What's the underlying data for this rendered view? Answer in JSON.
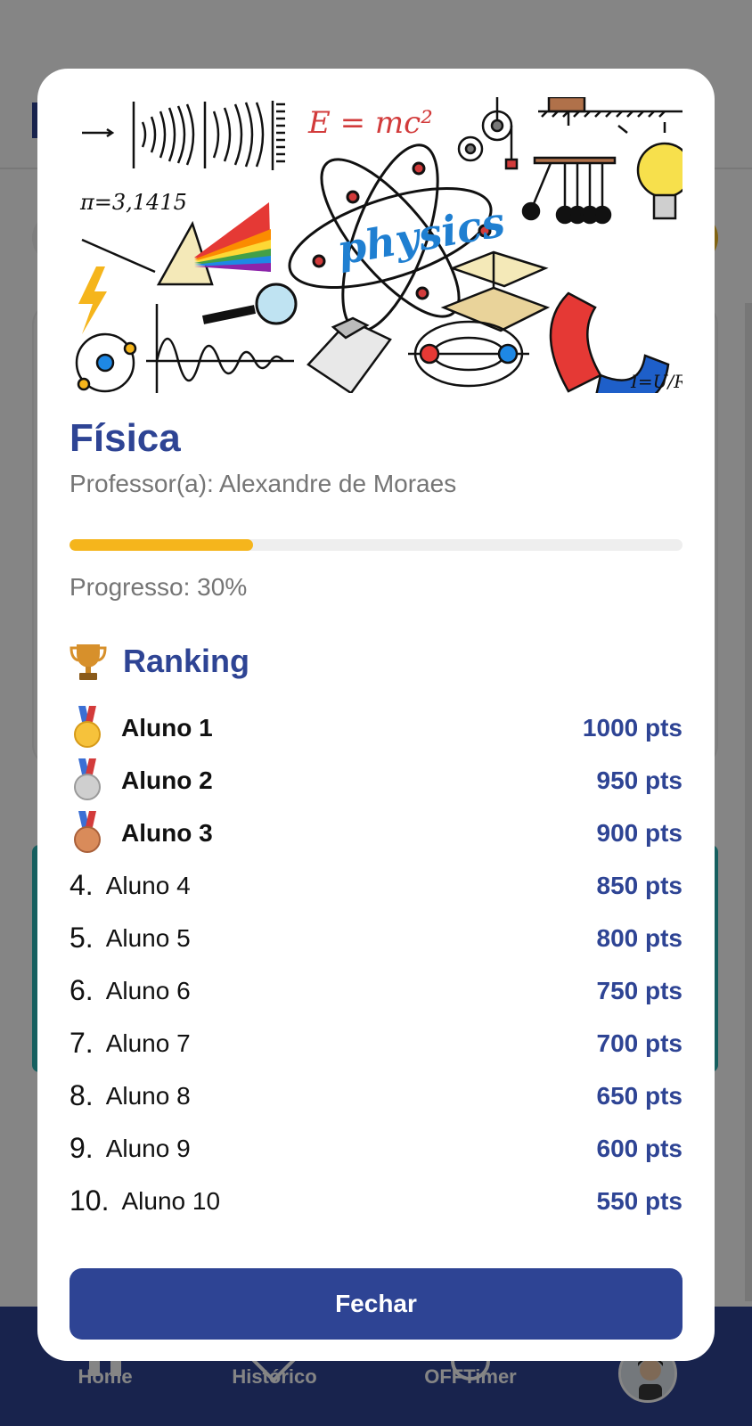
{
  "modal": {
    "course_title": "Física",
    "teacher": "Professor(a): Alexandre de Moraes",
    "progress_percent": 30,
    "progress_text": "Progresso: 30%",
    "ranking_title": "Ranking",
    "ranking_icon": "trophy-icon",
    "hero_text": {
      "formula": "E = mc²",
      "pi": "π=3,1415",
      "word": "physics",
      "ohm": "I=U/R"
    },
    "ranking": [
      {
        "position": "1.",
        "medal": "gold",
        "name": "Aluno 1",
        "points": "1000 pts"
      },
      {
        "position": "2.",
        "medal": "silver",
        "name": "Aluno 2",
        "points": "950 pts"
      },
      {
        "position": "3.",
        "medal": "bronze",
        "name": "Aluno 3",
        "points": "900 pts"
      },
      {
        "position": "4.",
        "medal": "",
        "name": "Aluno 4",
        "points": "850 pts"
      },
      {
        "position": "5.",
        "medal": "",
        "name": "Aluno 5",
        "points": "800 pts"
      },
      {
        "position": "6.",
        "medal": "",
        "name": "Aluno 6",
        "points": "750 pts"
      },
      {
        "position": "7.",
        "medal": "",
        "name": "Aluno 7",
        "points": "700 pts"
      },
      {
        "position": "8.",
        "medal": "",
        "name": "Aluno 8",
        "points": "650 pts"
      },
      {
        "position": "9.",
        "medal": "",
        "name": "Aluno 9",
        "points": "600 pts"
      },
      {
        "position": "10.",
        "medal": "",
        "name": "Aluno 10",
        "points": "550 pts"
      }
    ],
    "close_label": "Fechar"
  },
  "bottom_nav": {
    "items": [
      {
        "label": "Home",
        "icon": "home-icon"
      },
      {
        "label": "Histórico",
        "icon": "history-icon"
      },
      {
        "label": "OFFTimer",
        "icon": "timer-icon"
      }
    ],
    "avatar_icon": "avatar"
  },
  "colors": {
    "primary": "#2e4494",
    "accent": "#f5b51c",
    "muted_text": "#757575",
    "overlay": "rgba(0,0,0,0.48)"
  }
}
